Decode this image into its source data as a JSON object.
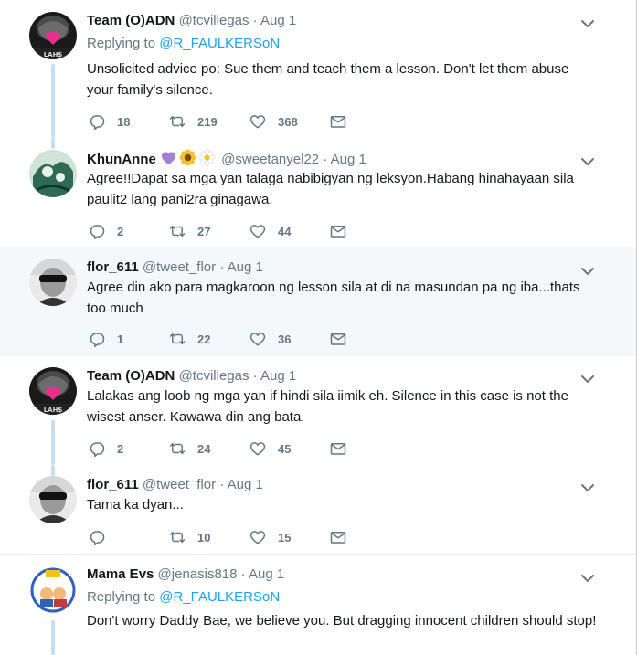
{
  "tweets": [
    {
      "name": "Team (O)ADN",
      "handle": "@tcvillegas",
      "dot": "·",
      "time": "Aug 1",
      "reply_prefix": "Replying to",
      "reply_user": "@R_FAULKERSoN",
      "text": "Unsolicited advice po: Sue them and teach them a lesson. Don't let them abuse your family's silence.",
      "replies": "18",
      "retweets": "219",
      "likes": "368"
    },
    {
      "name": "KhunAnne",
      "handle": "@sweetanyel22",
      "dot": "·",
      "time": "Aug 1",
      "emojis": [
        "purple-heart",
        "sunflower",
        "daisy"
      ],
      "text": "Agree!!Dapat sa mga yan talaga nabibigyan ng leksyon.Habang hinahayaan sila paulit2 lang pani2ra ginagawa.",
      "replies": "2",
      "retweets": "27",
      "likes": "44"
    },
    {
      "name": "flor_611",
      "handle": "@tweet_flor",
      "dot": "·",
      "time": "Aug 1",
      "text": "Agree din ako para magkaroon ng lesson sila at di na masundan pa ng iba...thats too much",
      "replies": "1",
      "retweets": "22",
      "likes": "36"
    },
    {
      "name": "Team (O)ADN",
      "handle": "@tcvillegas",
      "dot": "·",
      "time": "Aug 1",
      "text": "Lalakas ang loob ng mga yan if hindi sila iimik eh. Silence in this case is not the wisest anser. Kawawa din ang bata.",
      "replies": "2",
      "retweets": "24",
      "likes": "45"
    },
    {
      "name": "flor_611",
      "handle": "@tweet_flor",
      "dot": "·",
      "time": "Aug 1",
      "text": "Tama ka dyan...",
      "replies": "",
      "retweets": "10",
      "likes": "15"
    },
    {
      "name": "Mama Evs",
      "handle": "@jenasis818",
      "dot": "·",
      "time": "Aug 1",
      "reply_prefix": "Replying to",
      "reply_user": "@R_FAULKERSoN",
      "text": "Don't worry Daddy Bae, we believe you. But dragging innocent children should stop!"
    }
  ],
  "colors": {
    "link": "#1da1f2",
    "muted": "#657786",
    "text": "#14171a",
    "thread_line": "#c4dff0",
    "highlight": "#f5f8fa"
  },
  "icons": [
    "reply-icon",
    "retweet-icon",
    "like-icon",
    "message-icon",
    "chevron-down-icon"
  ]
}
